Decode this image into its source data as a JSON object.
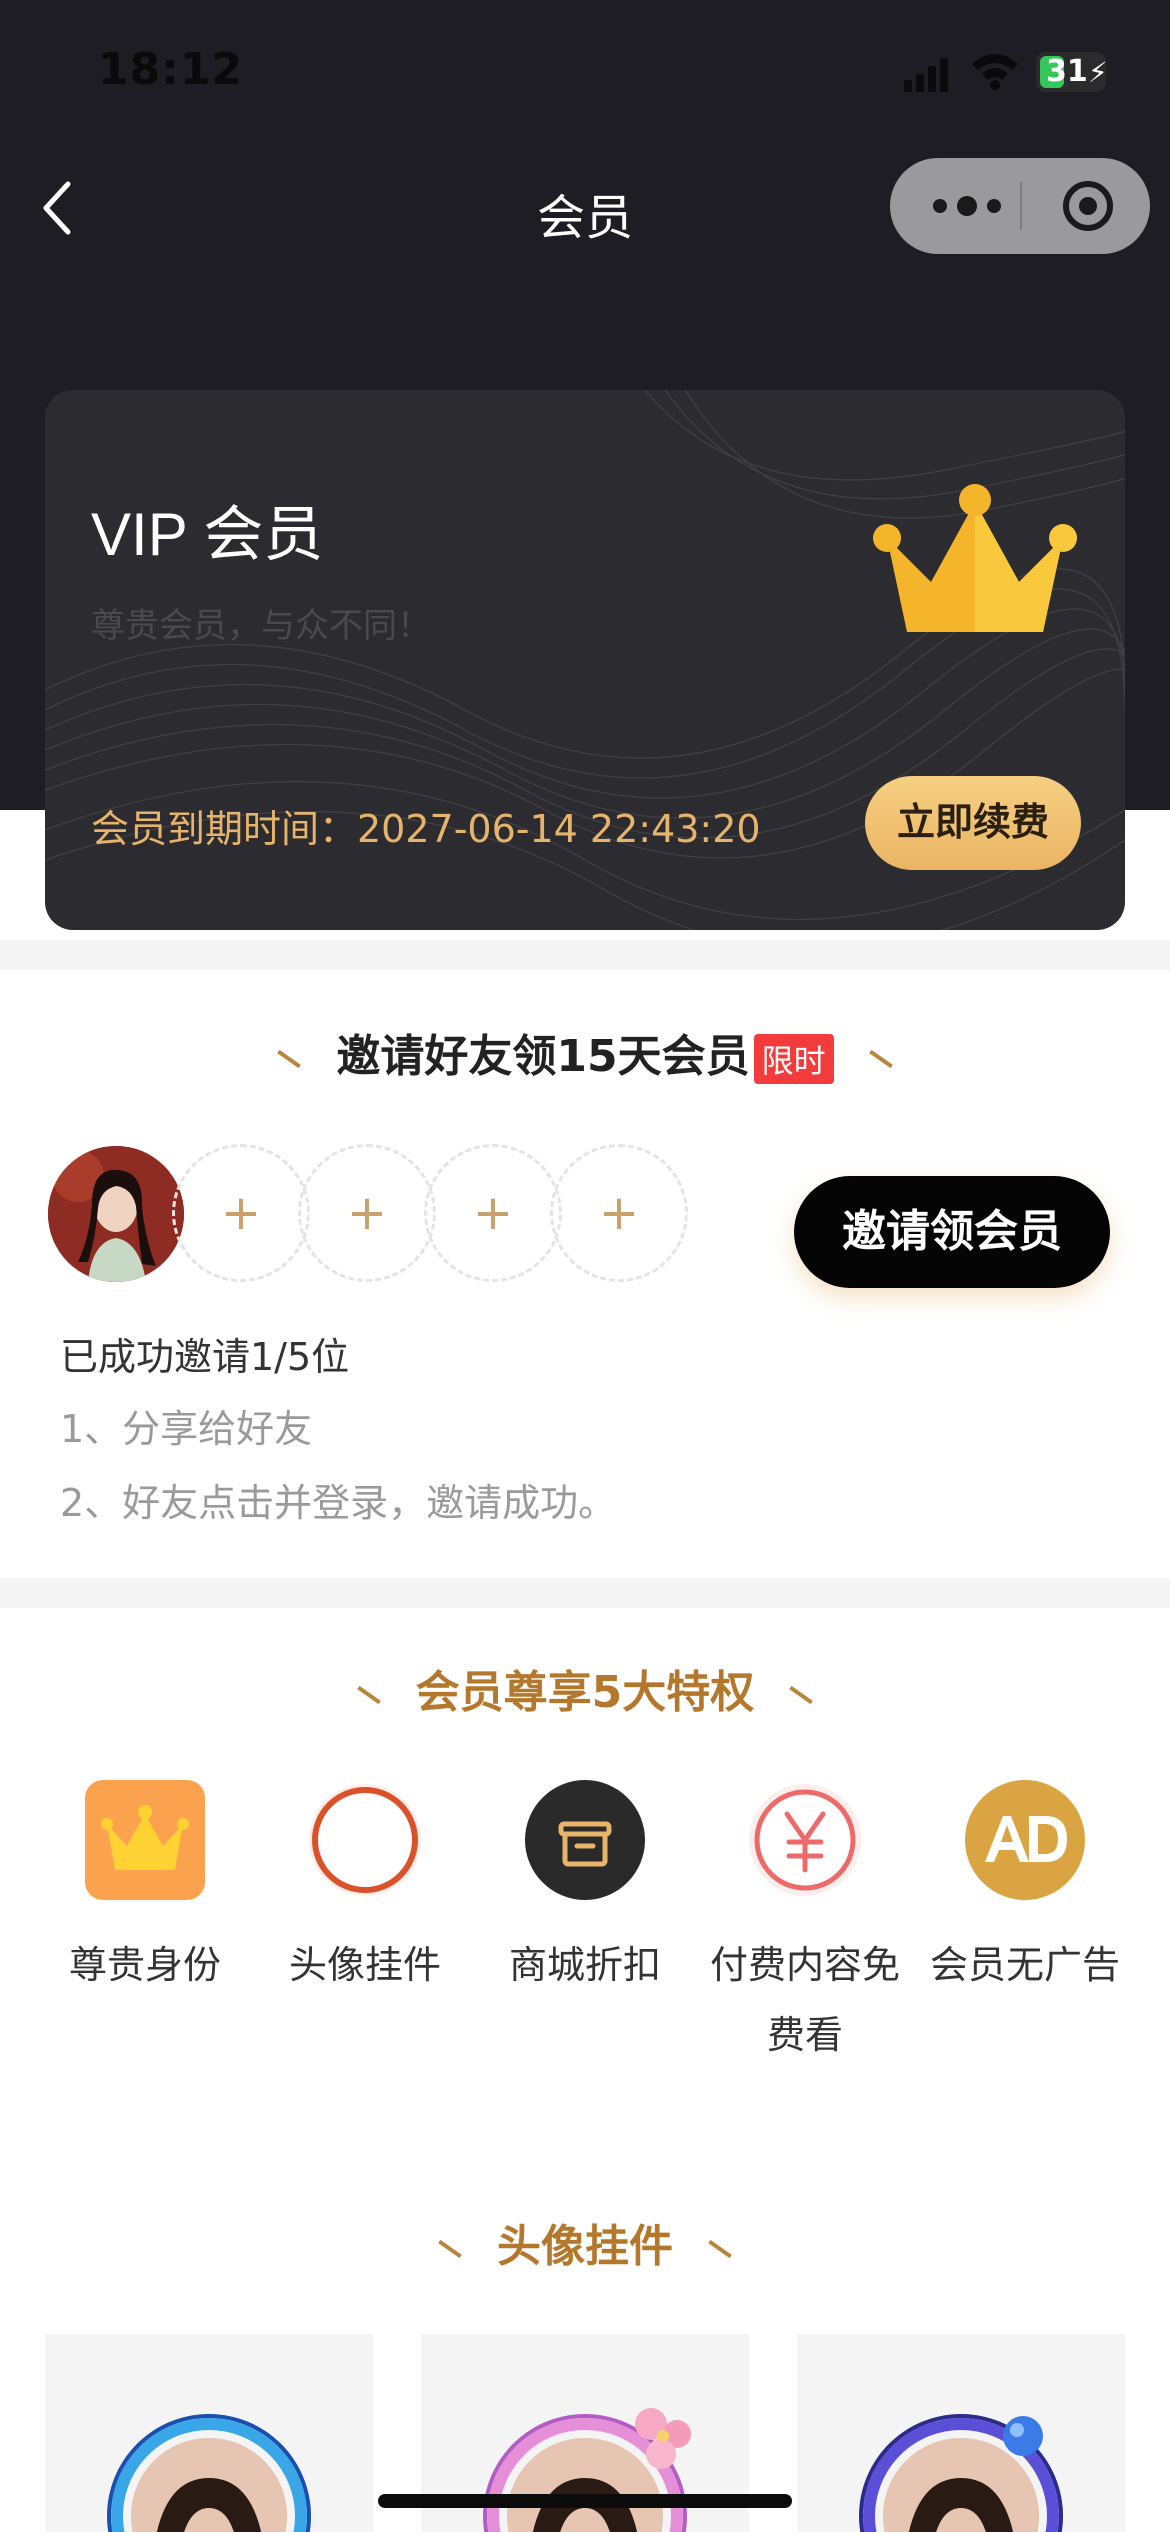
{
  "status_bar": {
    "time": "18:12",
    "battery": "31"
  },
  "nav": {
    "title": "会员"
  },
  "vip_card": {
    "title": "VIP 会员",
    "subtitle": "尊贵会员，与众不同！",
    "expire_text": "会员到期时间：2027-06-14 22:43:20",
    "renew_label": "立即续费",
    "accent_color": "#e7b46b"
  },
  "invite": {
    "title": "邀请好友领15天会员",
    "badge": "限时",
    "slots": [
      "+",
      "+",
      "+",
      "+"
    ],
    "button_label": "邀请领会员",
    "count_text": "已成功邀请1/5位",
    "steps": [
      "1、分享给好友",
      "2、好友点击并登录，邀请成功。"
    ]
  },
  "privileges": {
    "title": "会员尊享5大特权",
    "items": [
      {
        "label": "尊贵身份",
        "icon": "crown-icon"
      },
      {
        "label": "头像挂件",
        "icon": "ring-icon"
      },
      {
        "label": "商城折扣",
        "icon": "shop-icon"
      },
      {
        "label": "付费内容免费看",
        "icon": "yuan-icon"
      },
      {
        "label": "会员无广告",
        "icon": "ad-icon"
      }
    ]
  },
  "frames": {
    "title": "头像挂件"
  }
}
